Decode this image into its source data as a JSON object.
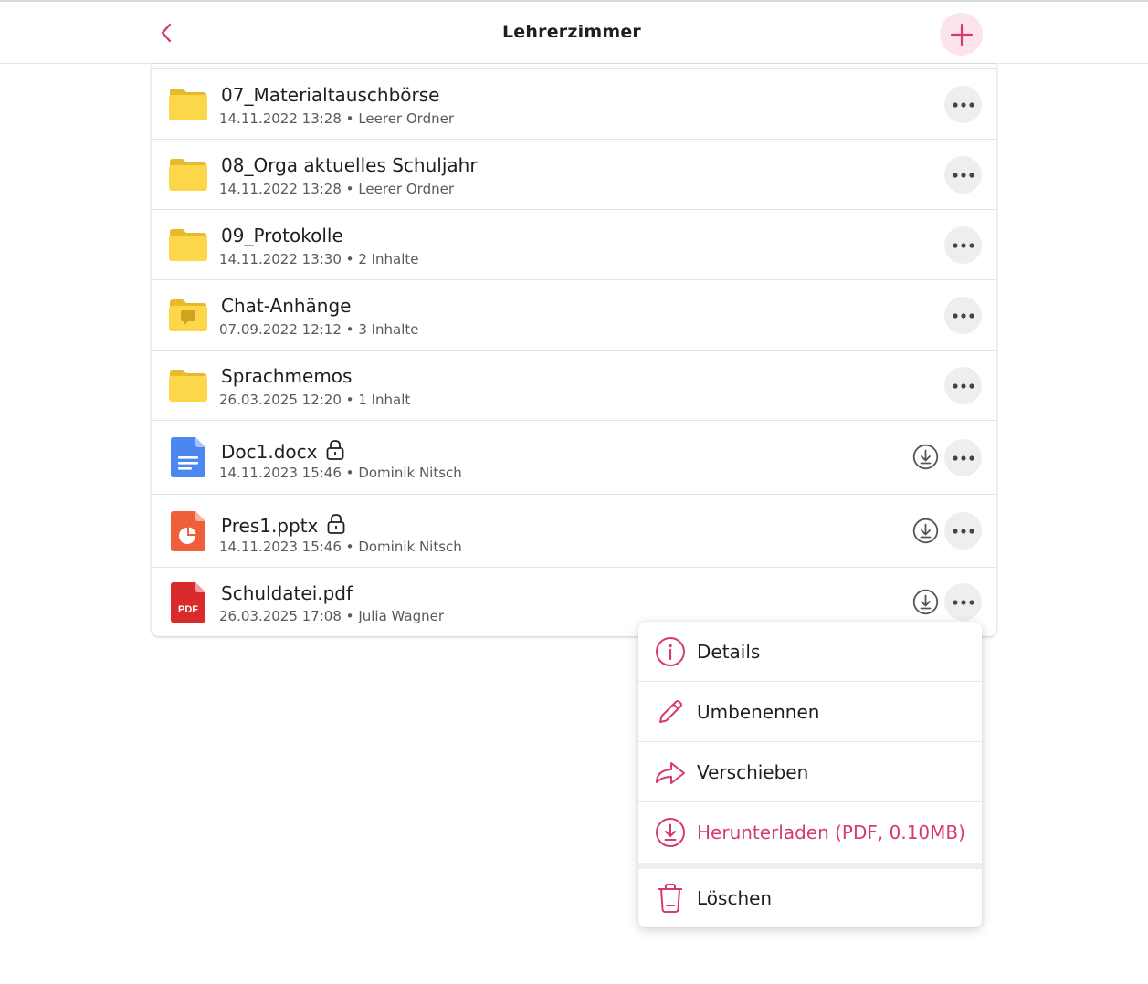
{
  "header": {
    "title": "Lehrerzimmer",
    "back_icon": "chevron-left-icon",
    "add_icon": "plus-icon"
  },
  "colors": {
    "accent": "#d63a73",
    "accent_soft": "#fbe4ec",
    "folder": "#fcd74a",
    "folder_tab": "#e7b92c",
    "docx": "#4b86f1",
    "pptx": "#f05f3b",
    "pdf": "#d92b2b"
  },
  "files": [
    {
      "name": "07_Materialtauschbörse",
      "date": "14.11.2022 13:28",
      "info": "Leerer Ordner",
      "type": "folder"
    },
    {
      "name": "08_Orga aktuelles Schuljahr",
      "date": "14.11.2022 13:28",
      "info": "Leerer Ordner",
      "type": "folder"
    },
    {
      "name": "09_Protokolle",
      "date": "14.11.2022 13:30",
      "info": "2 Inhalte",
      "type": "folder"
    },
    {
      "name": "Chat-Anhänge",
      "date": "07.09.2022 12:12",
      "info": "3 Inhalte",
      "type": "chat-folder"
    },
    {
      "name": "Sprachmemos",
      "date": "26.03.2025 12:20",
      "info": "1 Inhalt",
      "type": "folder"
    },
    {
      "name": "Doc1.docx",
      "date": "14.11.2023 15:46",
      "info": "Dominik Nitsch",
      "type": "docx",
      "locked": true
    },
    {
      "name": "Pres1.pptx",
      "date": "14.11.2023 15:46",
      "info": "Dominik Nitsch",
      "type": "pptx",
      "locked": true
    },
    {
      "name": "Schuldatei.pdf",
      "date": "26.03.2025 17:08",
      "info": "Julia Wagner",
      "type": "pdf",
      "badge": "PDF"
    }
  ],
  "separator": "•",
  "context_menu": {
    "items": [
      {
        "label": "Details",
        "icon": "info-icon"
      },
      {
        "label": "Umbenennen",
        "icon": "pencil-icon"
      },
      {
        "label": "Verschieben",
        "icon": "move-arrow-icon"
      },
      {
        "label": "Herunterladen (PDF, 0.10MB)",
        "icon": "download-icon"
      },
      {
        "label": "Löschen",
        "icon": "trash-icon"
      }
    ]
  }
}
